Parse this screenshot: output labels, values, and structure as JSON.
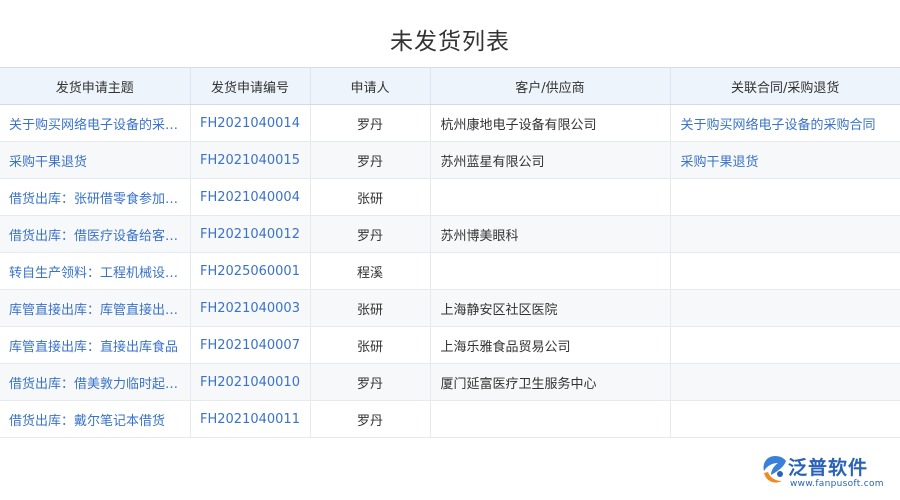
{
  "page": {
    "title": "未发货列表"
  },
  "table": {
    "columns": [
      "发货申请主题",
      "发货申请编号",
      "申请人",
      "客户/供应商",
      "关联合同/采购退货"
    ],
    "rows": [
      {
        "subject": "关于购买网络电子设备的采…",
        "number": "FH2021040014",
        "applicant": "罗丹",
        "customer": "杭州康地电子设备有限公司",
        "related": "关于购买网络电子设备的采购合同"
      },
      {
        "subject": "采购干果退货",
        "number": "FH2021040015",
        "applicant": "罗丹",
        "customer": "苏州蓝星有限公司",
        "related": "采购干果退货"
      },
      {
        "subject": "借货出库：张研借零食参加…",
        "number": "FH2021040004",
        "applicant": "张研",
        "customer": "",
        "related": ""
      },
      {
        "subject": "借货出库：借医疗设备给客…",
        "number": "FH2021040012",
        "applicant": "罗丹",
        "customer": "苏州博美眼科",
        "related": ""
      },
      {
        "subject": "转自生产领料：工程机械设…",
        "number": "FH2025060001",
        "applicant": "程溪",
        "customer": "",
        "related": ""
      },
      {
        "subject": "库管直接出库：库管直接出…",
        "number": "FH2021040003",
        "applicant": "张研",
        "customer": "上海静安区社区医院",
        "related": ""
      },
      {
        "subject": "库管直接出库：直接出库食品",
        "number": "FH2021040007",
        "applicant": "张研",
        "customer": "上海乐雅食品贸易公司",
        "related": ""
      },
      {
        "subject": "借货出库：借美敦力临时起…",
        "number": "FH2021040010",
        "applicant": "罗丹",
        "customer": "厦门延富医疗卫生服务中心",
        "related": ""
      },
      {
        "subject": "借货出库：戴尔笔记本借货",
        "number": "FH2021040011",
        "applicant": "罗丹",
        "customer": "",
        "related": ""
      }
    ]
  },
  "brand": {
    "name": "泛普软件",
    "url": "www.fanpusoft.com",
    "icon": "fanpu-logo-icon"
  },
  "colors": {
    "link": "#3a73c9",
    "header_bg": "#eef4fc",
    "stripe_bg": "#f7f8fa",
    "brand": "#2a62b5"
  }
}
